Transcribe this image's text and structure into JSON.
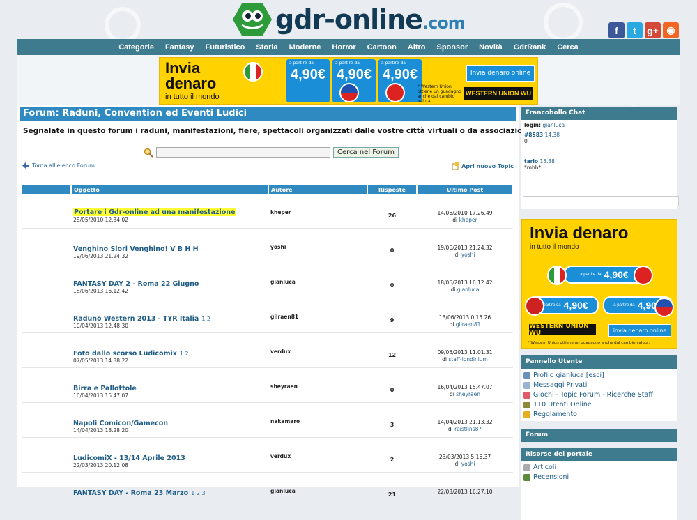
{
  "header": {
    "logo_name": "gdr-online",
    "logo_domain": ".com",
    "social": [
      {
        "icon": "facebook-icon",
        "glyph": "f",
        "color": "#3b5998"
      },
      {
        "icon": "twitter-icon",
        "glyph": "t",
        "color": "#29a9e1"
      },
      {
        "icon": "googleplus-icon",
        "glyph": "g+",
        "color": "#d34836"
      },
      {
        "icon": "rss-icon",
        "glyph": "◉",
        "color": "#f26522"
      }
    ]
  },
  "nav": [
    "Categorie",
    "Fantasy",
    "Futuristico",
    "Storia",
    "Moderne",
    "Horror",
    "Cartoon",
    "Altro",
    "Sponsor",
    "Novità",
    "GdrRank",
    "Cerca"
  ],
  "top_banner": {
    "headline_1": "Invia",
    "headline_2": "denaro",
    "subline": "in tutto il mondo",
    "price_label": "a partire da",
    "price": "4,90€",
    "cta": "Invia denaro online",
    "brand": "WESTERN UNION WU",
    "note": "* Western Union ottiene un guadagno anche dal cambio valuta."
  },
  "forum": {
    "title": "Forum: Raduni, Convention ed Eventi Ludici",
    "description": "Segnalate in questo forum i raduni, manifestazioni, fiere, spettacoli organizzati dalle vostre città virtuali o da associazioni di GDR...",
    "search_button": "Cerca nel Forum",
    "back_link": "Torna all'elenco Forum",
    "new_topic": "Apri nuovo Topic",
    "columns": {
      "subject": "Oggetto",
      "author": "Autore",
      "replies": "Risposte",
      "last": "Ultimo Post"
    },
    "by_prefix": "di",
    "topics": [
      {
        "title": "Portare i Gdr-online ad una manifestazione",
        "date": "28/05/2010 12.34.02",
        "author": "kheper",
        "replies": "26",
        "last_date": "14/06/2010 17.26.49",
        "last_by": "kheper",
        "pages": "",
        "highlight": true
      },
      {
        "title": "Venghino Siori Venghino! V B H H",
        "date": "19/06/2013 21.24.32",
        "author": "yoshi",
        "replies": "0",
        "last_date": "19/06/2013 21.24.32",
        "last_by": "yoshi",
        "pages": "",
        "highlight": false
      },
      {
        "title": "FANTASY DAY 2 - Roma 22 Giugno",
        "date": "18/06/2013 16.12.42",
        "author": "gianluca",
        "replies": "0",
        "last_date": "18/06/2013 16.12.42",
        "last_by": "gianluca",
        "pages": "",
        "highlight": false
      },
      {
        "title": "Raduno Western 2013 - TYR Italia",
        "date": "10/04/2013 12.48.30",
        "author": "gilraen81",
        "replies": "9",
        "last_date": "13/06/2013 0.15.26",
        "last_by": "gilraen81",
        "pages": "1 2",
        "highlight": false
      },
      {
        "title": "Foto dallo scorso Ludicomix",
        "date": "07/05/2013 14.38.22",
        "author": "verdux",
        "replies": "12",
        "last_date": "09/05/2013 11.01.31",
        "last_by": "staff-londinium",
        "pages": "1 2",
        "highlight": false
      },
      {
        "title": "Birra e Pallottole",
        "date": "16/04/2013 15.47.07",
        "author": "sheyraen",
        "replies": "0",
        "last_date": "16/04/2013 15.47.07",
        "last_by": "sheyraen",
        "pages": "",
        "highlight": false
      },
      {
        "title": "Napoli Comicon/Gamecon",
        "date": "14/04/2013 18.28.20",
        "author": "nakamaro",
        "replies": "3",
        "last_date": "14/04/2013 21.13.32",
        "last_by": "raistlins87",
        "pages": "",
        "highlight": false
      },
      {
        "title": "LudicomiX - 13/14 Aprile 2013",
        "date": "22/03/2013 20.12.08",
        "author": "verdux",
        "replies": "2",
        "last_date": "23/03/2013 5.16.37",
        "last_by": "yoshi",
        "pages": "",
        "highlight": false
      },
      {
        "title": "FANTASY DAY - Roma 23 Marzo",
        "date": "",
        "author": "gianluca",
        "replies": "21",
        "last_date": "22/03/2013 16.27.10",
        "last_by": "",
        "pages": "1 2 3",
        "highlight": false
      }
    ]
  },
  "chat": {
    "title": "Francobollo Chat",
    "login_label": "login:",
    "login_user": "gianluca",
    "messages": [
      {
        "name": "#8583",
        "time": "14.38",
        "text": "0"
      },
      {
        "name": "tarlo",
        "time": "15.38",
        "text": "*mhh*"
      }
    ]
  },
  "side_ad": {
    "headline": "Invia denaro",
    "subline": "in tutto il mondo",
    "pill_label": "a partire da",
    "price": "4,90€",
    "brand": "WESTERN UNION WU",
    "cta": "invia denaro online",
    "note": "* Western Union ottiene un guadagno anche dal cambio valuta."
  },
  "user_panel": {
    "title": "Pannello Utente",
    "items": [
      {
        "label": "Profilo gianluca [esci]",
        "icon": "user-icon",
        "color": "#6a8fb8"
      },
      {
        "label": "Messaggi Privati",
        "icon": "mail-icon",
        "color": "#9ab4d4"
      },
      {
        "label": "Giochi - Topic Forum - Ricerche Staff",
        "icon": "heart-icon",
        "color": "#e05a6a"
      },
      {
        "label": "110 Utenti Online",
        "icon": "users-icon",
        "color": "#8a8a3a"
      },
      {
        "label": "Regolamento",
        "icon": "shield-icon",
        "color": "#e8b020"
      }
    ]
  },
  "forum_box": {
    "title": "Forum"
  },
  "resources": {
    "title": "Risorse del portale",
    "items": [
      {
        "label": "Articoli",
        "icon": "document-icon",
        "color": "#aaaaaa"
      },
      {
        "label": "Recensioni",
        "icon": "review-icon",
        "color": "#5a8a3a"
      }
    ]
  }
}
